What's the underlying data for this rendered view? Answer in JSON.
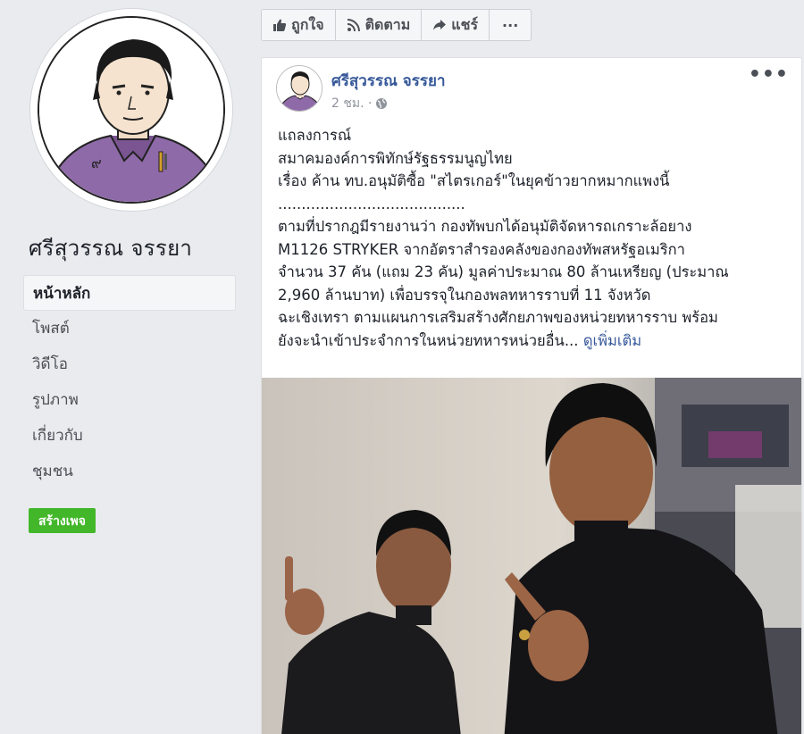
{
  "page": {
    "name": "ศรีสุวรรณ จรรยา"
  },
  "nav": {
    "items": [
      {
        "label": "หน้าหลัก",
        "active": true
      },
      {
        "label": "โพสต์",
        "active": false
      },
      {
        "label": "วิดีโอ",
        "active": false
      },
      {
        "label": "รูปภาพ",
        "active": false
      },
      {
        "label": "เกี่ยวกับ",
        "active": false
      },
      {
        "label": "ชุมชน",
        "active": false
      }
    ],
    "create_page_label": "สร้างเพจ"
  },
  "actions": {
    "like_label": "ถูกใจ",
    "follow_label": "ติดตาม",
    "share_label": "แชร์",
    "more_label": "···"
  },
  "post": {
    "author": "ศรีสุวรรณ จรรยา",
    "time": "2 ชม. ·",
    "more_label": "•••",
    "lines": [
      "แถลงการณ์",
      "สมาคมองค์การพิทักษ์รัฐธรรมนูญไทย",
      "เรื่อง ค้าน ทบ.อนุมัติซื้อ \"สไตรเกอร์\"ในยุคข้าวยากหมากแพงนี้",
      "........................................",
      "ตามที่ปรากฎมีรายงานว่า กองทัพบกได้อนุมัติจัดหารถเกราะล้อยาง",
      "M1126 STRYKER จากอัตราสำรองคลังของกองทัพสหรัฐอเมริกา",
      "จำนวน 37 คัน (แถม 23 คัน) มูลค่าประมาณ 80 ล้านเหรียญ (ประมาณ",
      "2,960 ล้านบาท) เพื่อบรรจุในกองพลทหารราบที่ 11 จังหวัด",
      "ฉะเชิงเทรา ตามแผนการเสริมสร้างศักยภาพของหน่วยทหารราบ พร้อม"
    ],
    "last_line": "ยังจะนำเข้าประจำการในหน่วยทหารหน่วยอื่น...",
    "see_more": "ดูเพิ่มเติม"
  },
  "colors": {
    "link": "#365899",
    "create_button": "#42b72a",
    "background": "#e9ebee"
  },
  "icons": {
    "like": "thumbs-up-icon",
    "follow": "rss-icon",
    "share": "share-arrow-icon",
    "audience": "globe-icon"
  }
}
